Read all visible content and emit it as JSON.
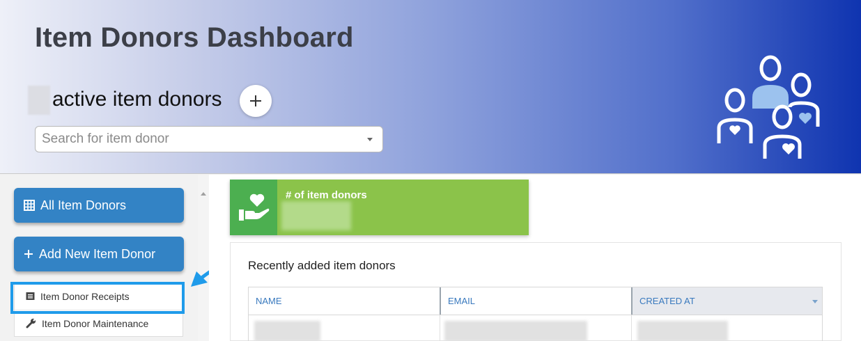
{
  "header": {
    "title": "Item Donors Dashboard",
    "active_label": "active item donors",
    "add_button_icon": "plus-icon",
    "search": {
      "placeholder": "Search for item donor",
      "value": ""
    },
    "illustration_icon": "people-with-hearts-icon"
  },
  "sidebar": {
    "buttons": [
      {
        "label": "All Item Donors",
        "icon": "table-grid-icon"
      },
      {
        "label": "Add New Item Donor",
        "icon": "plus-icon"
      }
    ],
    "items": [
      {
        "label": "Item Donor Receipts",
        "icon": "receipt-icon"
      },
      {
        "label": "Item Donor Maintenance",
        "icon": "wrench-icon"
      }
    ]
  },
  "stats": {
    "card_label": "# of item donors",
    "icon": "hand-heart-icon",
    "colors": {
      "card": "#8bc34a",
      "icon_box": "#4caf50"
    }
  },
  "recent": {
    "title": "Recently added item donors",
    "columns": [
      "NAME",
      "EMAIL",
      "CREATED AT"
    ],
    "sorted_column": "CREATED AT"
  },
  "colors": {
    "accent_button": "#3383c5",
    "highlight_annotation": "#1f9bea",
    "column_header_text": "#3979be"
  }
}
